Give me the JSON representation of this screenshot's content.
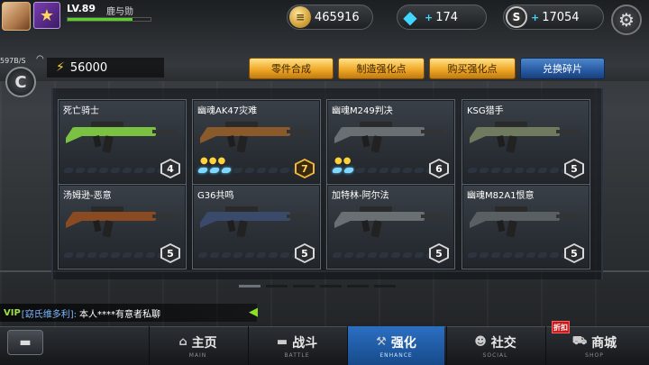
{
  "player": {
    "level": "LV.89",
    "name": "鹿与勋",
    "xp": 0.78
  },
  "resources": {
    "gold": "465916",
    "diamond": "174",
    "s_points": "17054",
    "s_icon_label": "S"
  },
  "status": {
    "net_speed": "597B/S",
    "c_label": "C",
    "energy": "56000"
  },
  "tabs": [
    "零件合成",
    "制造强化点",
    "购买强化点",
    "兑换碎片"
  ],
  "weapons": [
    {
      "name": "死亡骑士",
      "stars": 0,
      "pips": 0,
      "level": "4",
      "gold": false
    },
    {
      "name": "幽魂AK47灾难",
      "stars": 3,
      "pips": 3,
      "level": "7",
      "gold": true
    },
    {
      "name": "幽魂M249判决",
      "stars": 2,
      "pips": 2,
      "level": "6",
      "gold": false
    },
    {
      "name": "KSG猎手",
      "stars": 0,
      "pips": 0,
      "level": "5",
      "gold": false
    },
    {
      "name": "汤姆逊-恶意",
      "stars": 0,
      "pips": 0,
      "level": "5",
      "gold": false
    },
    {
      "name": "G36共鸣",
      "stars": 0,
      "pips": 0,
      "level": "5",
      "gold": false
    },
    {
      "name": "加特林-阿尔法",
      "stars": 0,
      "pips": 0,
      "level": "5",
      "gold": false
    },
    {
      "name": "幽魂M82A1恨意",
      "stars": 0,
      "pips": 0,
      "level": "5",
      "gold": false
    }
  ],
  "chat": {
    "vip": "VIP",
    "channel": "[窈氏维多利]:",
    "message": "本人****有意者私聊"
  },
  "nav": [
    {
      "label": "主页",
      "sub": "MAIN",
      "icon": "home-icon"
    },
    {
      "label": "战斗",
      "sub": "BATTLE",
      "icon": "gun-icon"
    },
    {
      "label": "强化",
      "sub": "ENHANCE",
      "icon": "hammer-icon"
    },
    {
      "label": "社交",
      "sub": "SOCIAL",
      "icon": "people-icon"
    },
    {
      "label": "商城",
      "sub": "SHOP",
      "icon": "cart-icon"
    }
  ],
  "sale_badge": "折扣"
}
